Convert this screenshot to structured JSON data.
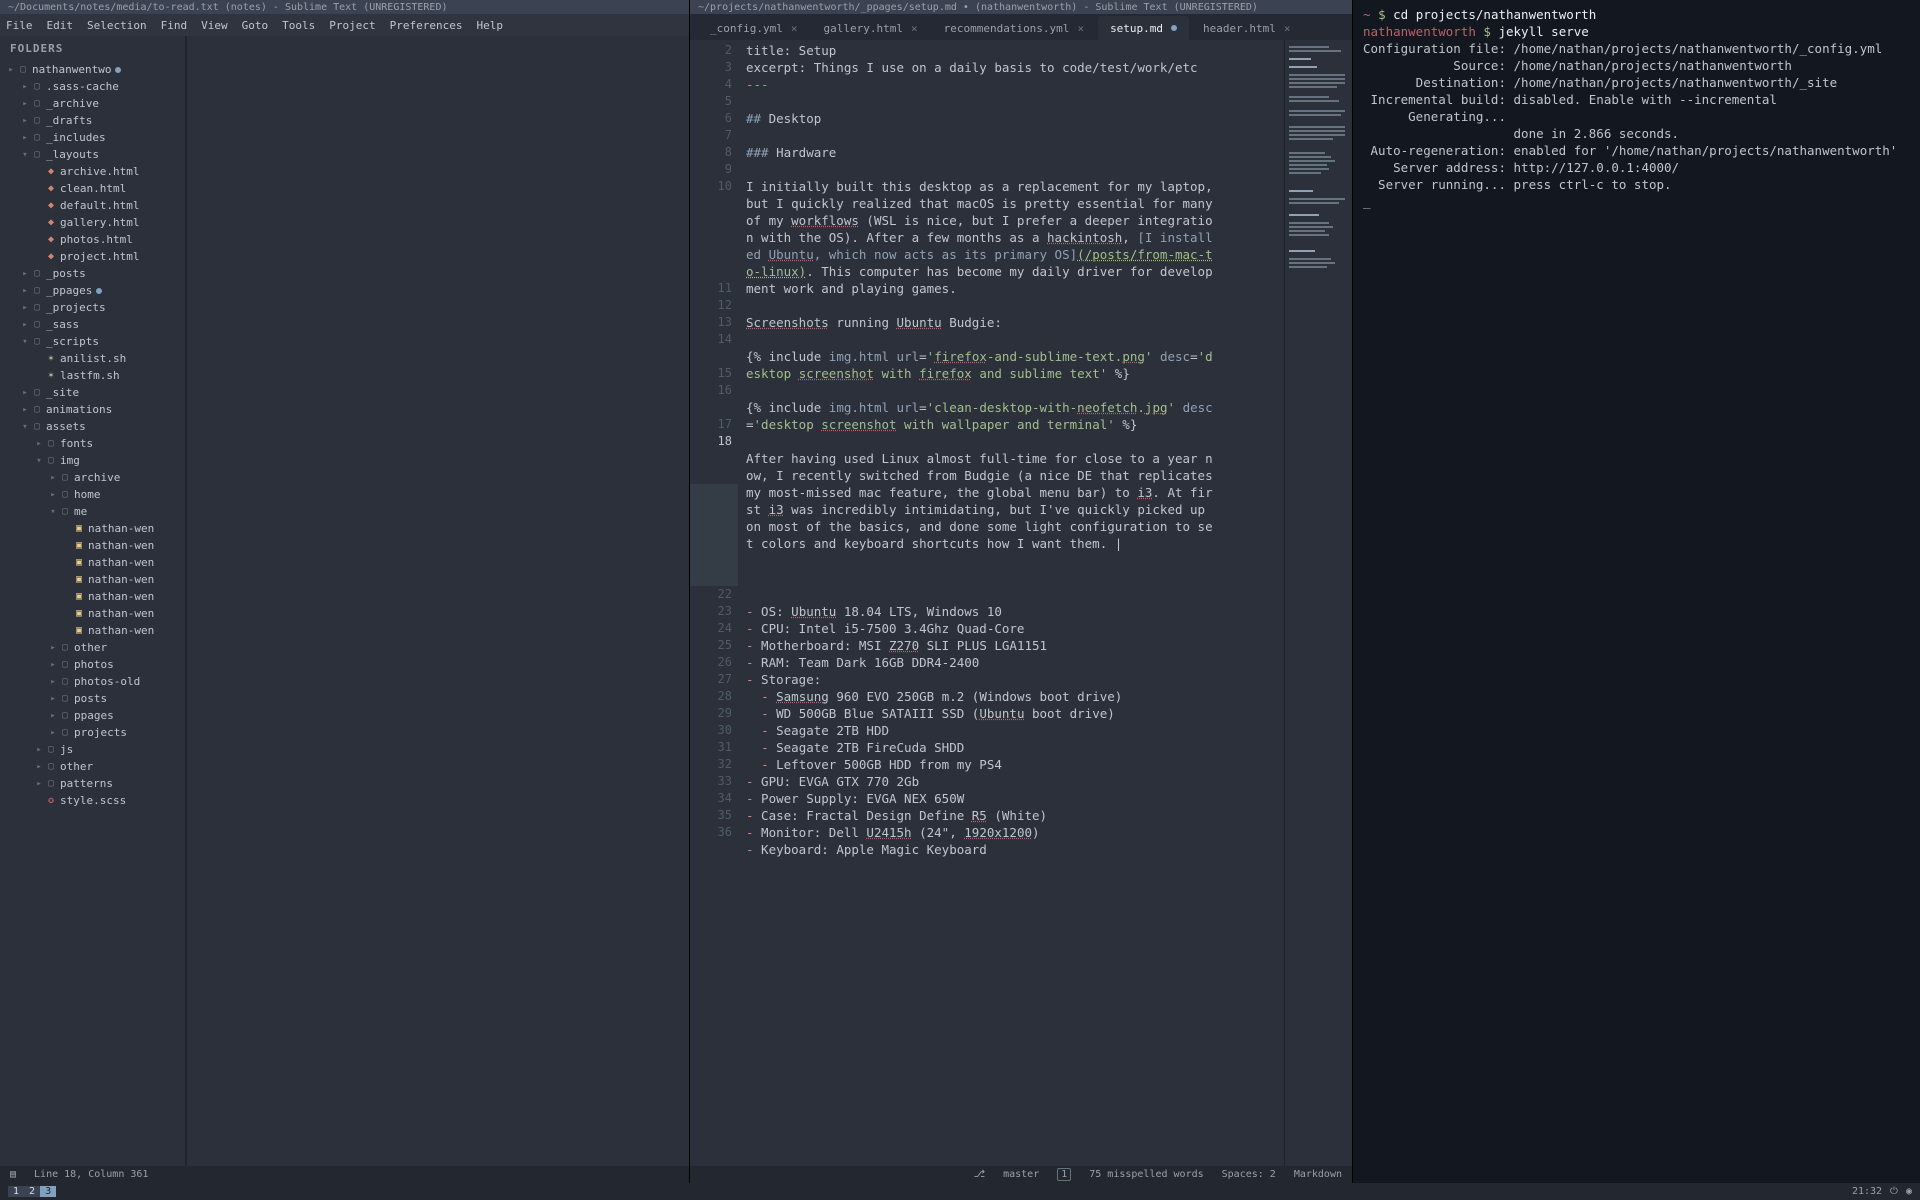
{
  "left_window": {
    "title": "~/Documents/notes/media/to-read.txt (notes) - Sublime Text (UNREGISTERED)",
    "menubar": [
      "File",
      "Edit",
      "Selection",
      "Find",
      "View",
      "Goto",
      "Tools",
      "Project",
      "Preferences",
      "Help"
    ],
    "sidebar_header": "FOLDERS",
    "tree": [
      {
        "d": 0,
        "t": "root",
        "icon": "▸",
        "label": "nathanwentwo",
        "dirty": true
      },
      {
        "d": 1,
        "t": "folder",
        "icon": "▸",
        "label": ".sass-cache"
      },
      {
        "d": 1,
        "t": "folder",
        "icon": "▸",
        "label": "_archive"
      },
      {
        "d": 1,
        "t": "folder",
        "icon": "▸",
        "label": "_drafts"
      },
      {
        "d": 1,
        "t": "folder",
        "icon": "▸",
        "label": "_includes"
      },
      {
        "d": 1,
        "t": "folder-open",
        "icon": "▾",
        "label": "_layouts"
      },
      {
        "d": 2,
        "t": "html",
        "label": "archive.html"
      },
      {
        "d": 2,
        "t": "html",
        "label": "clean.html"
      },
      {
        "d": 2,
        "t": "html",
        "label": "default.html"
      },
      {
        "d": 2,
        "t": "html",
        "label": "gallery.html"
      },
      {
        "d": 2,
        "t": "html",
        "label": "photos.html"
      },
      {
        "d": 2,
        "t": "html",
        "label": "project.html"
      },
      {
        "d": 1,
        "t": "folder",
        "icon": "▸",
        "label": "_posts"
      },
      {
        "d": 1,
        "t": "folder",
        "icon": "▸",
        "label": "_ppages",
        "dirty": true
      },
      {
        "d": 1,
        "t": "folder",
        "icon": "▸",
        "label": "_projects"
      },
      {
        "d": 1,
        "t": "folder",
        "icon": "▸",
        "label": "_sass"
      },
      {
        "d": 1,
        "t": "folder-open",
        "icon": "▾",
        "label": "_scripts"
      },
      {
        "d": 2,
        "t": "sh",
        "label": "anilist.sh"
      },
      {
        "d": 2,
        "t": "sh",
        "label": "lastfm.sh"
      },
      {
        "d": 1,
        "t": "folder",
        "icon": "▸",
        "label": "_site"
      },
      {
        "d": 1,
        "t": "folder",
        "icon": "▸",
        "label": "animations"
      },
      {
        "d": 1,
        "t": "folder-open",
        "icon": "▾",
        "label": "assets"
      },
      {
        "d": 2,
        "t": "folder",
        "icon": "▸",
        "label": "fonts"
      },
      {
        "d": 2,
        "t": "folder-open",
        "icon": "▾",
        "label": "img"
      },
      {
        "d": 3,
        "t": "folder",
        "icon": "▸",
        "label": "archive"
      },
      {
        "d": 3,
        "t": "folder",
        "icon": "▸",
        "label": "home"
      },
      {
        "d": 3,
        "t": "folder-open",
        "icon": "▾",
        "label": "me"
      },
      {
        "d": 4,
        "t": "img",
        "label": "nathan-wen"
      },
      {
        "d": 4,
        "t": "img",
        "label": "nathan-wen"
      },
      {
        "d": 4,
        "t": "img",
        "label": "nathan-wen"
      },
      {
        "d": 4,
        "t": "img",
        "label": "nathan-wen"
      },
      {
        "d": 4,
        "t": "img",
        "label": "nathan-wen"
      },
      {
        "d": 4,
        "t": "img",
        "label": "nathan-wen"
      },
      {
        "d": 4,
        "t": "img",
        "label": "nathan-wen"
      },
      {
        "d": 3,
        "t": "folder",
        "icon": "▸",
        "label": "other"
      },
      {
        "d": 3,
        "t": "folder",
        "icon": "▸",
        "label": "photos"
      },
      {
        "d": 3,
        "t": "folder",
        "icon": "▸",
        "label": "photos-old"
      },
      {
        "d": 3,
        "t": "folder",
        "icon": "▸",
        "label": "posts"
      },
      {
        "d": 3,
        "t": "folder",
        "icon": "▸",
        "label": "ppages"
      },
      {
        "d": 3,
        "t": "folder",
        "icon": "▸",
        "label": "projects"
      },
      {
        "d": 2,
        "t": "folder",
        "icon": "▸",
        "label": "js"
      },
      {
        "d": 2,
        "t": "folder",
        "icon": "▸",
        "label": "other"
      },
      {
        "d": 2,
        "t": "folder",
        "icon": "▸",
        "label": "patterns"
      },
      {
        "d": 2,
        "t": "css",
        "label": "style.scss"
      }
    ],
    "status": {
      "line_col": "Line 18, Column 361"
    }
  },
  "right_window": {
    "title": "~/projects/nathanwentworth/_ppages/setup.md • (nathanwentworth) - Sublime Text (UNREGISTERED)",
    "tabs": [
      {
        "label": "_config.yml",
        "active": false,
        "dirty": false
      },
      {
        "label": "gallery.html",
        "active": false,
        "dirty": false
      },
      {
        "label": "recommendations.yml",
        "active": false,
        "dirty": false
      },
      {
        "label": "setup.md",
        "active": true,
        "dirty": true
      },
      {
        "label": "header.html",
        "active": false,
        "dirty": false
      }
    ],
    "first_line_no": 2,
    "status": {
      "branch": "master",
      "branch_badge": "1",
      "misspelled": "75 misspelled words",
      "spaces": "Spaces: 2",
      "syntax": "Markdown"
    }
  },
  "terminal": {
    "lines": [
      {
        "prompt": true,
        "user": "~",
        "cmd": "cd projects/nathanwentworth"
      },
      {
        "prompt": true,
        "user": "nathanwentworth",
        "cmd": "jekyll serve"
      },
      {
        "text": "Configuration file: /home/nathan/projects/nathanwentworth/_config.yml"
      },
      {
        "text": "            Source: /home/nathan/projects/nathanwentworth"
      },
      {
        "text": "       Destination: /home/nathan/projects/nathanwentworth/_site"
      },
      {
        "text": " Incremental build: disabled. Enable with --incremental"
      },
      {
        "text": "      Generating..."
      },
      {
        "text": "                    done in 2.866 seconds."
      },
      {
        "text": " Auto-regeneration: enabled for '/home/nathan/projects/nathanwentworth'"
      },
      {
        "text": "    Server address: http://127.0.0.1:4000/"
      },
      {
        "text": "  Server running... press ctrl-c to stop."
      },
      {
        "text": "_"
      }
    ]
  },
  "taskbar": {
    "workspaces": [
      "1",
      "2",
      "3"
    ],
    "active_ws": 2,
    "clock": "21:32"
  }
}
